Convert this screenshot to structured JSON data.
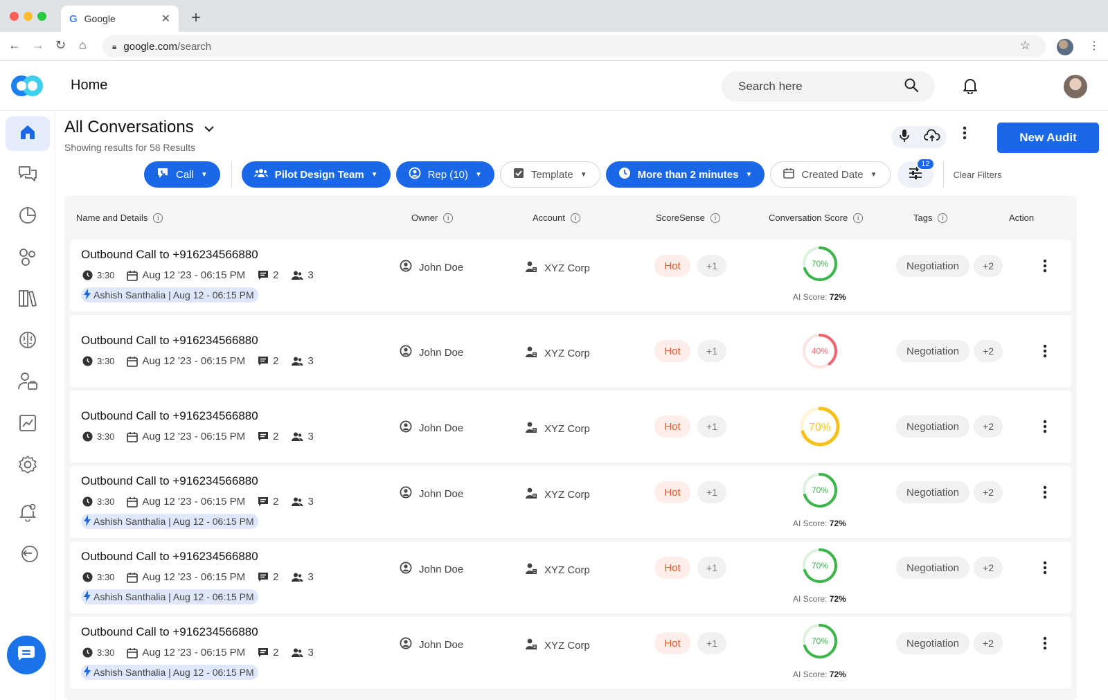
{
  "browser": {
    "tab_title": "Google",
    "url_host": "google.com",
    "url_path": "/search"
  },
  "header": {
    "title": "Home",
    "search_placeholder": "Search here"
  },
  "sidebar": {
    "items": [
      {
        "icon": "home-icon",
        "active": true
      },
      {
        "icon": "chat-icon"
      },
      {
        "icon": "pie-chart-icon"
      },
      {
        "icon": "bubbles-icon"
      },
      {
        "icon": "library-icon"
      },
      {
        "icon": "brain-icon"
      },
      {
        "icon": "user-briefcase-icon"
      },
      {
        "icon": "trend-chart-icon"
      },
      {
        "icon": "gear-icon"
      },
      {
        "icon": "notification-bell-icon"
      },
      {
        "icon": "logout-icon"
      }
    ]
  },
  "main": {
    "title": "All Conversations",
    "results_text": "Showing results for 58 Results",
    "new_audit_label": "New Audit",
    "filters": [
      {
        "label": "Call",
        "style": "blue",
        "icon": "call-icon"
      },
      {
        "label": "Pilot Design Team",
        "style": "blue",
        "icon": "team-icon"
      },
      {
        "label": "Rep (10)",
        "style": "blue",
        "icon": "user-circle-icon"
      },
      {
        "label": "Template",
        "style": "gray",
        "icon": "checkbox-icon"
      },
      {
        "label": "More than 2 minutes",
        "style": "blue",
        "icon": "clock-icon"
      },
      {
        "label": "Created Date",
        "style": "gray",
        "icon": "calendar-icon"
      }
    ],
    "filter_badge": "12",
    "clear_filters_label": "Clear Filters"
  },
  "table": {
    "columns": [
      "Name and Details",
      "Owner",
      "Account",
      "ScoreSense",
      "Conversation Score",
      "Tags",
      "Action"
    ],
    "rows": [
      {
        "title": "Outbound Call to +916234566880",
        "duration": "3:30",
        "date": "Aug 12 '23 - 06:15 PM",
        "comments": "2",
        "participants": "3",
        "rep": "Ashish Santhalia | Aug 12 - 06:15 PM",
        "owner": "John Doe",
        "account": "XYZ Corp",
        "score_sense": "Hot",
        "score_sense_more": "+1",
        "score": 70,
        "score_label": "70%",
        "ring_color": "#3bb54a",
        "ai_label": "AI Score:",
        "ai_score": "72%",
        "tag": "Negotiation",
        "tag_more": "+2"
      },
      {
        "title": "Outbound Call to +916234566880",
        "duration": "3:30",
        "date": "Aug 12 '23 - 06:15 PM",
        "comments": "2",
        "participants": "3",
        "owner": "John Doe",
        "account": "XYZ Corp",
        "score_sense": "Hot",
        "score_sense_more": "+1",
        "score": 40,
        "score_label": "40%",
        "ring_color": "#f0656b",
        "tag": "Negotiation",
        "tag_more": "+2"
      },
      {
        "title": "Outbound Call to +916234566880",
        "duration": "3:30",
        "date": "Aug 12 '23 - 06:15 PM",
        "comments": "2",
        "participants": "3",
        "owner": "John Doe",
        "account": "XYZ Corp",
        "score_sense": "Hot",
        "score_sense_more": "+1",
        "score": 70,
        "score_label": "70%",
        "ring_color": "#f4c21a",
        "tag": "Negotiation",
        "tag_more": "+2"
      },
      {
        "title": "Outbound Call to +916234566880",
        "duration": "3:30",
        "date": "Aug 12 '23 - 06:15 PM",
        "comments": "2",
        "participants": "3",
        "rep": "Ashish Santhalia | Aug 12 - 06:15 PM",
        "owner": "John Doe",
        "account": "XYZ Corp",
        "score_sense": "Hot",
        "score_sense_more": "+1",
        "score": 70,
        "score_label": "70%",
        "ring_color": "#3bb54a",
        "ai_label": "AI Score:",
        "ai_score": "72%",
        "tag": "Negotiation",
        "tag_more": "+2"
      },
      {
        "title": "Outbound Call to +916234566880",
        "duration": "3:30",
        "date": "Aug 12 '23 - 06:15 PM",
        "comments": "2",
        "participants": "3",
        "rep": "Ashish Santhalia | Aug 12 - 06:15 PM",
        "owner": "John Doe",
        "account": "XYZ Corp",
        "score_sense": "Hot",
        "score_sense_more": "+1",
        "score": 70,
        "score_label": "70%",
        "ring_color": "#3bb54a",
        "ai_label": "AI Score:",
        "ai_score": "72%",
        "tag": "Negotiation",
        "tag_more": "+2"
      },
      {
        "title": "Outbound Call to +916234566880",
        "duration": "3:30",
        "date": "Aug 12 '23 - 06:15 PM",
        "comments": "2",
        "participants": "3",
        "rep": "Ashish Santhalia | Aug 12 - 06:15 PM",
        "owner": "John Doe",
        "account": "XYZ Corp",
        "score_sense": "Hot",
        "score_sense_more": "+1",
        "score": 70,
        "score_label": "70%",
        "ring_color": "#3bb54a",
        "ai_label": "AI Score:",
        "ai_score": "72%",
        "tag": "Negotiation",
        "tag_more": "+2"
      }
    ]
  },
  "colors": {
    "primary": "#1a67e8",
    "hot_text": "#e8572d",
    "hot_bg": "#fdeee9",
    "score_green": "#3bb54a",
    "score_red": "#f0656b",
    "score_yellow": "#f4c21a"
  }
}
